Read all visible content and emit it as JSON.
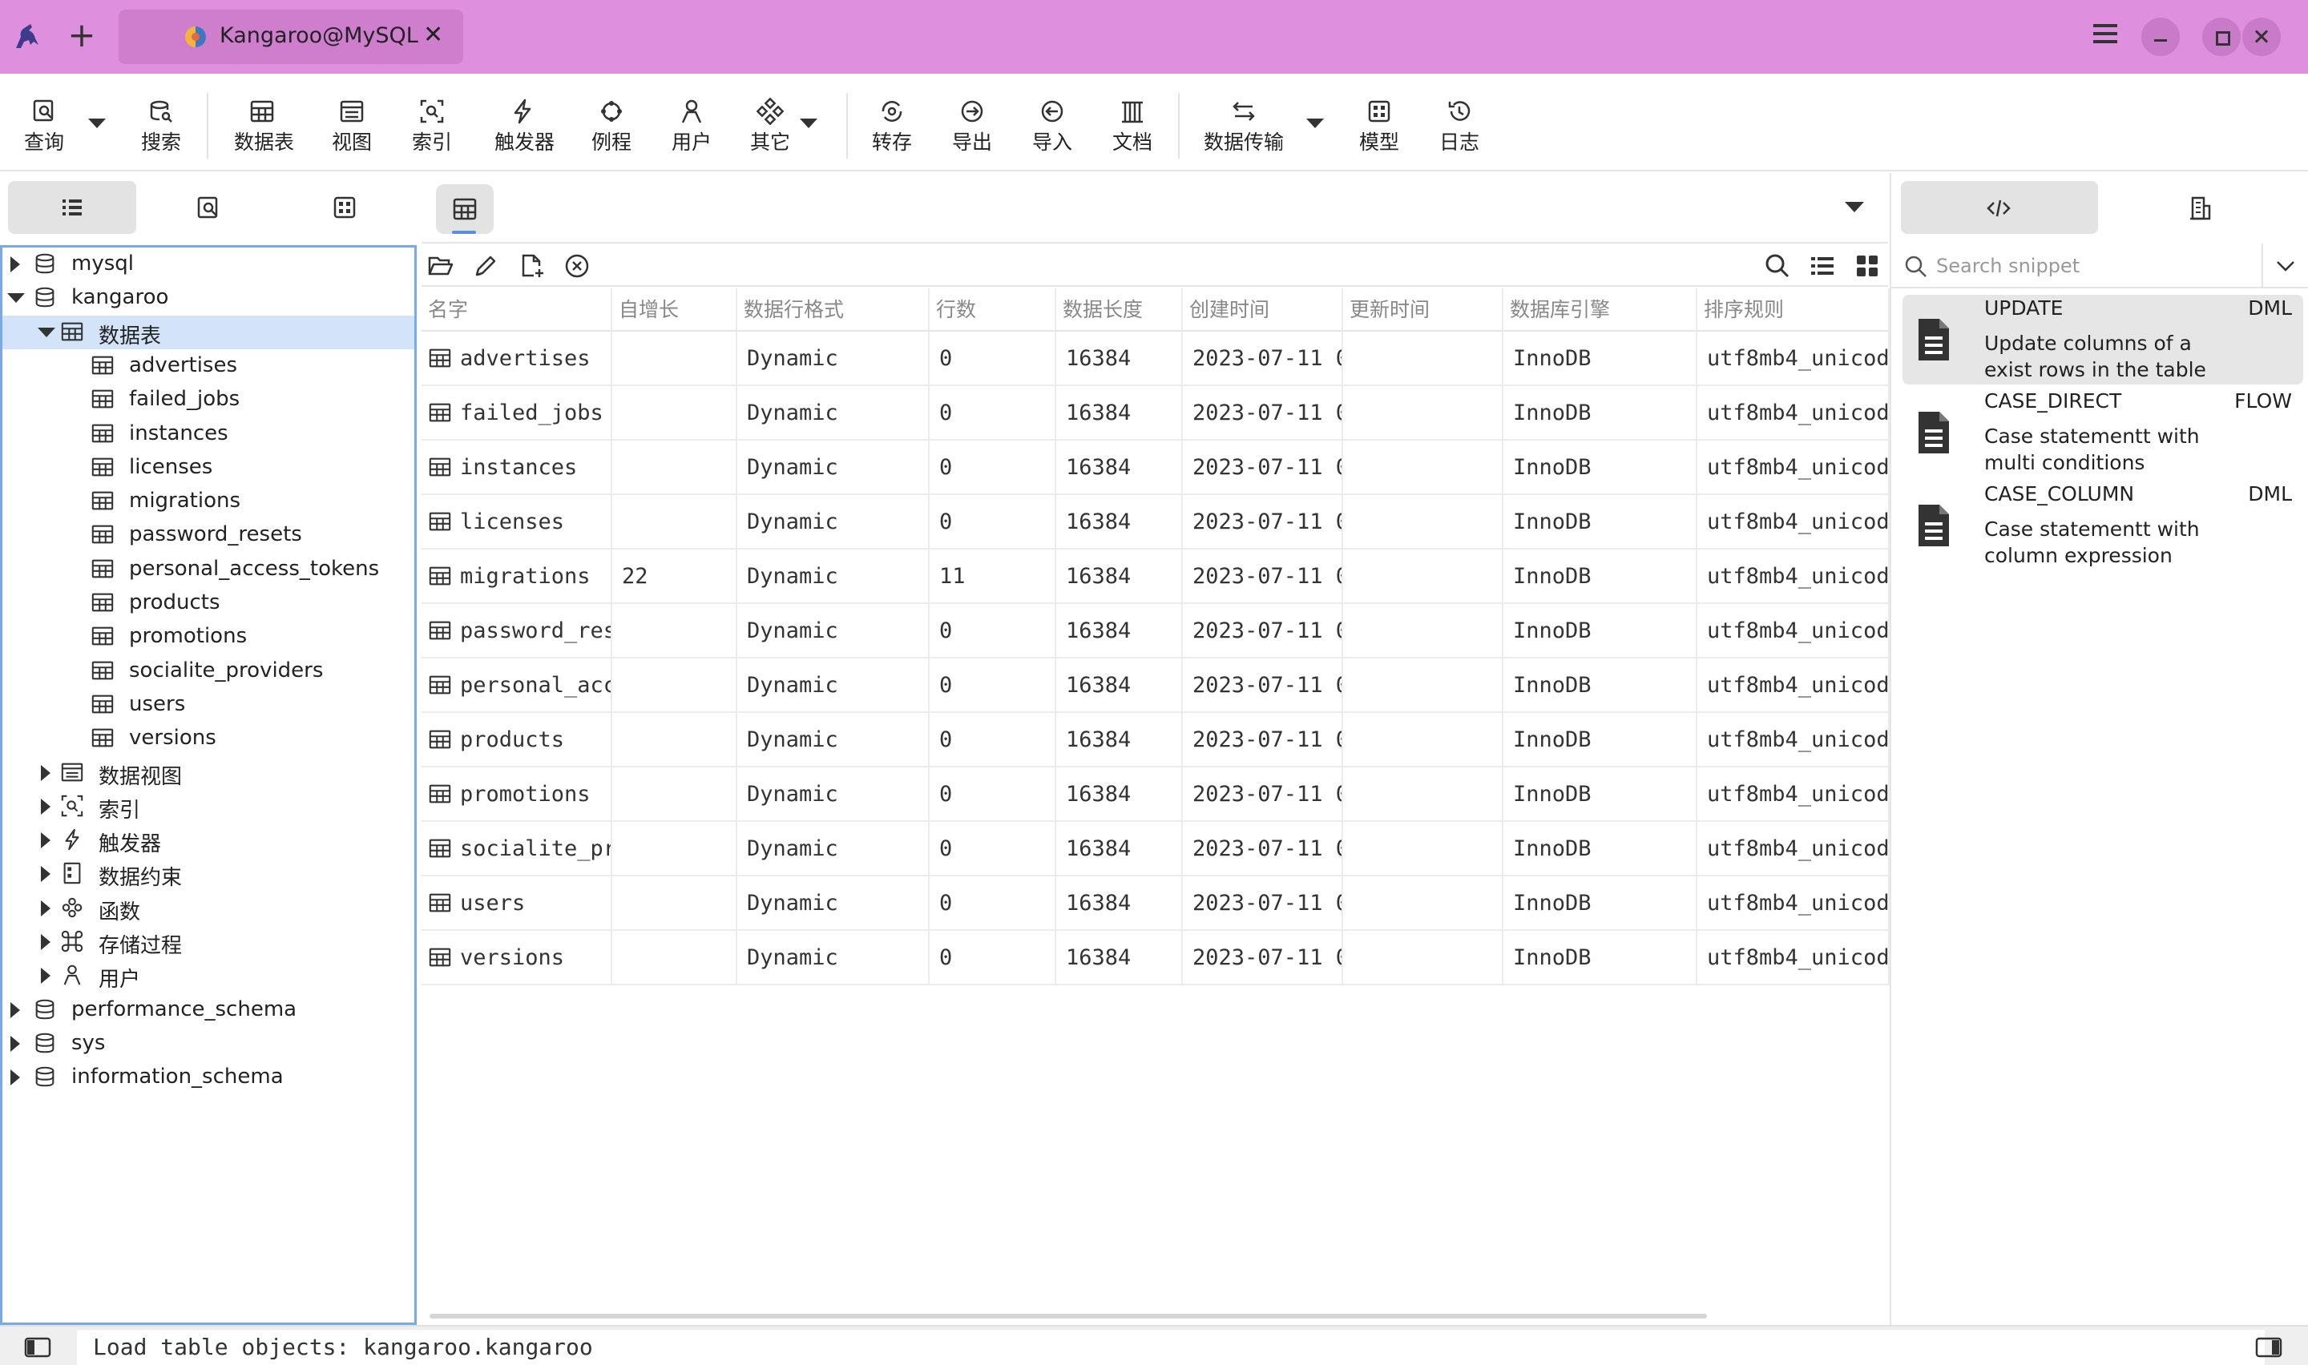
{
  "window": {
    "tab_title": "Kangaroo@MySQL"
  },
  "toolbar": [
    {
      "label": "查询",
      "icon": "query-icon"
    },
    {
      "label": "搜索",
      "icon": "search-db-icon"
    },
    {
      "label": "数据表",
      "icon": "table-icon"
    },
    {
      "label": "视图",
      "icon": "view-icon"
    },
    {
      "label": "索引",
      "icon": "index-icon"
    },
    {
      "label": "触发器",
      "icon": "trigger-icon"
    },
    {
      "label": "例程",
      "icon": "routine-icon"
    },
    {
      "label": "用户",
      "icon": "user-icon"
    },
    {
      "label": "其它",
      "icon": "other-icon"
    },
    {
      "label": "转存",
      "icon": "dump-icon"
    },
    {
      "label": "导出",
      "icon": "export-icon"
    },
    {
      "label": "导入",
      "icon": "import-icon"
    },
    {
      "label": "文档",
      "icon": "document-icon"
    },
    {
      "label": "数据传输",
      "icon": "transfer-icon"
    },
    {
      "label": "模型",
      "icon": "model-icon"
    },
    {
      "label": "日志",
      "icon": "log-icon"
    }
  ],
  "tree": [
    {
      "label": "mysql",
      "type": "db",
      "state": "collapsed"
    },
    {
      "label": "kangaroo",
      "type": "db",
      "state": "expanded"
    },
    {
      "label": "数据表",
      "type": "folder-table",
      "state": "expanded",
      "selected": true
    },
    {
      "label": "advertises",
      "type": "table"
    },
    {
      "label": "failed_jobs",
      "type": "table"
    },
    {
      "label": "instances",
      "type": "table"
    },
    {
      "label": "licenses",
      "type": "table"
    },
    {
      "label": "migrations",
      "type": "table"
    },
    {
      "label": "password_resets",
      "type": "table"
    },
    {
      "label": "personal_access_tokens",
      "type": "table"
    },
    {
      "label": "products",
      "type": "table"
    },
    {
      "label": "promotions",
      "type": "table"
    },
    {
      "label": "socialite_providers",
      "type": "table"
    },
    {
      "label": "users",
      "type": "table"
    },
    {
      "label": "versions",
      "type": "table"
    },
    {
      "label": "数据视图",
      "type": "folder-view",
      "state": "collapsed"
    },
    {
      "label": "索引",
      "type": "folder-index",
      "state": "collapsed"
    },
    {
      "label": "触发器",
      "type": "folder-trigger",
      "state": "collapsed"
    },
    {
      "label": "数据约束",
      "type": "folder-constraint",
      "state": "collapsed"
    },
    {
      "label": "函数",
      "type": "folder-function",
      "state": "collapsed"
    },
    {
      "label": "存储过程",
      "type": "folder-procedure",
      "state": "collapsed"
    },
    {
      "label": "用户",
      "type": "folder-user",
      "state": "collapsed"
    },
    {
      "label": "performance_schema",
      "type": "db",
      "state": "collapsed"
    },
    {
      "label": "sys",
      "type": "db",
      "state": "collapsed"
    },
    {
      "label": "information_schema",
      "type": "db",
      "state": "collapsed"
    }
  ],
  "grid": {
    "columns": [
      "名字",
      "自增长",
      "数据行格式",
      "行数",
      "数据长度",
      "创建时间",
      "更新时间",
      "数据库引擎",
      "排序规则"
    ],
    "rows": [
      [
        "advertises",
        "",
        "Dynamic",
        "0",
        "16384",
        "2023-07-11 0",
        "",
        "InnoDB",
        "utf8mb4_unicod"
      ],
      [
        "failed_jobs",
        "",
        "Dynamic",
        "0",
        "16384",
        "2023-07-11 0",
        "",
        "InnoDB",
        "utf8mb4_unicod"
      ],
      [
        "instances",
        "",
        "Dynamic",
        "0",
        "16384",
        "2023-07-11 0",
        "",
        "InnoDB",
        "utf8mb4_unicod"
      ],
      [
        "licenses",
        "",
        "Dynamic",
        "0",
        "16384",
        "2023-07-11 0",
        "",
        "InnoDB",
        "utf8mb4_unicod"
      ],
      [
        "migrations",
        "22",
        "Dynamic",
        "11",
        "16384",
        "2023-07-11 0",
        "",
        "InnoDB",
        "utf8mb4_unicod"
      ],
      [
        "password_res",
        "",
        "Dynamic",
        "0",
        "16384",
        "2023-07-11 0",
        "",
        "InnoDB",
        "utf8mb4_unicod"
      ],
      [
        "personal_acc",
        "",
        "Dynamic",
        "0",
        "16384",
        "2023-07-11 0",
        "",
        "InnoDB",
        "utf8mb4_unicod"
      ],
      [
        "products",
        "",
        "Dynamic",
        "0",
        "16384",
        "2023-07-11 0",
        "",
        "InnoDB",
        "utf8mb4_unicod"
      ],
      [
        "promotions",
        "",
        "Dynamic",
        "0",
        "16384",
        "2023-07-11 0",
        "",
        "InnoDB",
        "utf8mb4_unicod"
      ],
      [
        "socialite_pr",
        "",
        "Dynamic",
        "0",
        "16384",
        "2023-07-11 0",
        "",
        "InnoDB",
        "utf8mb4_unicod"
      ],
      [
        "users",
        "",
        "Dynamic",
        "0",
        "16384",
        "2023-07-11 0",
        "",
        "InnoDB",
        "utf8mb4_unicod"
      ],
      [
        "versions",
        "",
        "Dynamic",
        "0",
        "16384",
        "2023-07-11 0",
        "",
        "InnoDB",
        "utf8mb4_unicod"
      ]
    ]
  },
  "snippets": {
    "search_placeholder": "Search snippet",
    "items": [
      {
        "name": "UPDATE",
        "tag": "DML",
        "desc": "Update columns of a exist rows in the table"
      },
      {
        "name": "CASE_DIRECT",
        "tag": "FLOW",
        "desc": "Case statementt with multi conditions"
      },
      {
        "name": "CASE_COLUMN",
        "tag": "DML",
        "desc": "Case statementt with column expression"
      }
    ]
  },
  "status": {
    "message": "Load table objects: kangaroo.kangaroo"
  },
  "colors": {
    "titlebar": "#de8fdd",
    "tab": "#cf7ece",
    "selection": "#d3e4f9",
    "focus_border": "#7aa9e8"
  }
}
